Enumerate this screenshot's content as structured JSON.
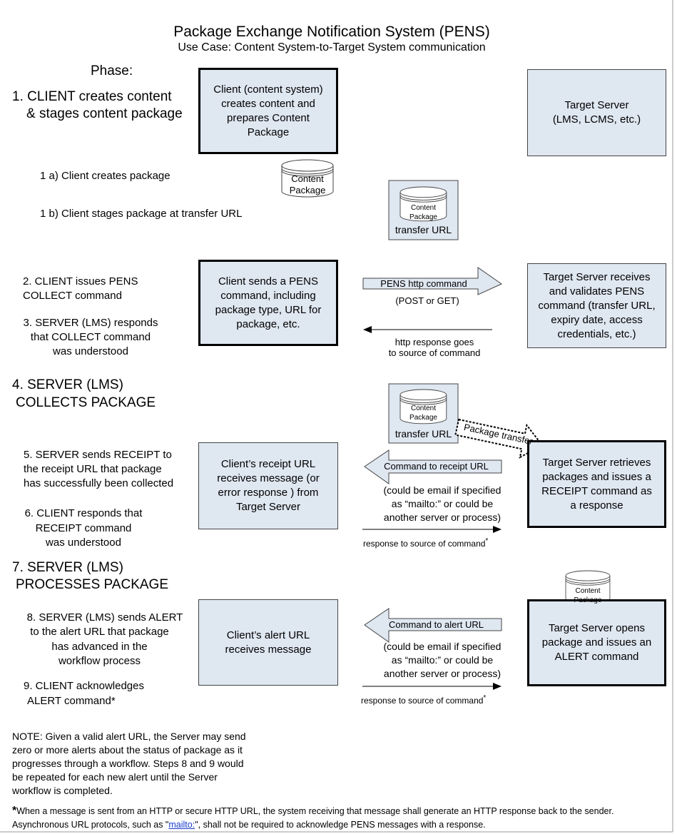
{
  "header": {
    "title": "Package Exchange Notification System   (PENS)",
    "subtitle": "Use Case: Content System-to-Target System communication"
  },
  "phase_label": "Phase:",
  "phases": {
    "p1": [
      "1. CLIENT creates content",
      "&  stages content package"
    ],
    "p1a": "1 a) Client creates package",
    "p1b": "1 b) Client stages package at transfer URL",
    "p2": [
      "2. CLIENT issues PENS",
      "COLLECT command"
    ],
    "p3": [
      "3. SERVER (LMS) responds",
      "that COLLECT command",
      "was understood"
    ],
    "p4": [
      "4. SERVER (LMS)",
      "COLLECTS PACKAGE"
    ],
    "p5": [
      "5. SERVER sends RECEIPT to",
      "the receipt URL that package",
      "has successfully been collected"
    ],
    "p6": [
      "6. CLIENT responds that",
      "RECEIPT command",
      "was understood"
    ],
    "p7": [
      "7. SERVER (LMS)",
      "PROCESSES PACKAGE"
    ],
    "p8": [
      "8. SERVER (LMS) sends ALERT",
      "to the alert URL that package",
      "has advanced in the",
      "workflow process"
    ],
    "p9": [
      "9. CLIENT acknowledges",
      "ALERT command*"
    ]
  },
  "boxes": {
    "client1": [
      "Client (content system)",
      "creates content and",
      "prepares Content",
      "Package"
    ],
    "target1": [
      "Target Server",
      "(LMS, LCMS, etc.)"
    ],
    "client2": [
      "Client sends a PENS",
      "command, including",
      "package type, URL for",
      "package, etc."
    ],
    "target2": [
      "Target Server receives",
      "and validates PENS",
      "command (transfer URL,",
      "expiry date, access",
      "credentials, etc.)"
    ],
    "client3": [
      "Client’s receipt URL",
      "receives message (or",
      "error response ) from",
      "Target Server"
    ],
    "target3": [
      "Target  Server retrieves",
      "packages and issues  a",
      "RECEIPT command as",
      "a response"
    ],
    "client4": [
      "Client’s alert URL",
      "receives message"
    ],
    "target4": [
      "Target Server opens",
      "package and issues an",
      "ALERT command"
    ]
  },
  "cylinders": {
    "content_package": [
      "Content",
      "Package"
    ],
    "transfer_url": "transfer URL"
  },
  "arrows": {
    "pens_command": "PENS http command",
    "post_get": "(POST or GET)",
    "http_response": [
      "http response goes",
      "to source of command"
    ],
    "package_transfer": "Package transfer",
    "receipt_cmd": "Command to receipt URL",
    "alert_cmd": "Command to alert URL",
    "could_be": [
      "(could be email if specified",
      "as “mailto:” or could be",
      "another server or process)"
    ],
    "response_source": "response to source of command",
    "star": "*"
  },
  "note": [
    "NOTE: Given a valid alert URL, the Server may send",
    "zero or more alerts about the status of package as it",
    "progresses through a workflow. Steps 8 and 9 would",
    "be repeated for each new alert until the Server",
    "workflow is completed."
  ],
  "footnote": {
    "star": "*",
    "line1": "When a message is sent from an HTTP or secure HTTP URL, the system receiving that message shall generate an HTTP response back to the sender.",
    "line2_pre": "Asynchronous URL protocols, such as \"",
    "link": "mailto:",
    "line2_post": "\", shall not be required to acknowledge PENS messages with a response."
  },
  "colors": {
    "box_fill": "#dfe7f1",
    "border": "#000000"
  }
}
